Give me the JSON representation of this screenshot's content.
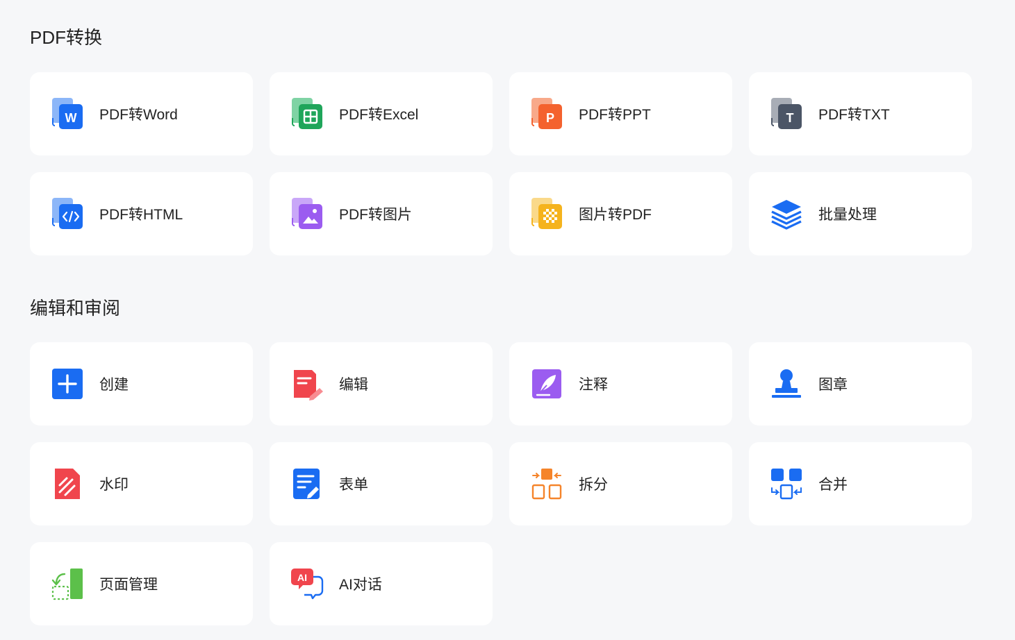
{
  "sections": [
    {
      "title": "PDF转换",
      "items": [
        {
          "label": "PDF转Word",
          "icon": "pdf-to-word-icon"
        },
        {
          "label": "PDF转Excel",
          "icon": "pdf-to-excel-icon"
        },
        {
          "label": "PDF转PPT",
          "icon": "pdf-to-ppt-icon"
        },
        {
          "label": "PDF转TXT",
          "icon": "pdf-to-txt-icon"
        },
        {
          "label": "PDF转HTML",
          "icon": "pdf-to-html-icon"
        },
        {
          "label": "PDF转图片",
          "icon": "pdf-to-image-icon"
        },
        {
          "label": "图片转PDF",
          "icon": "image-to-pdf-icon"
        },
        {
          "label": "批量处理",
          "icon": "batch-layers-icon"
        }
      ]
    },
    {
      "title": "编辑和审阅",
      "items": [
        {
          "label": "创建",
          "icon": "create-plus-icon"
        },
        {
          "label": "编辑",
          "icon": "edit-document-icon"
        },
        {
          "label": "注释",
          "icon": "annotate-feather-icon"
        },
        {
          "label": "图章",
          "icon": "stamp-icon"
        },
        {
          "label": "水印",
          "icon": "watermark-icon"
        },
        {
          "label": "表单",
          "icon": "form-icon"
        },
        {
          "label": "拆分",
          "icon": "split-icon"
        },
        {
          "label": "合并",
          "icon": "merge-icon"
        },
        {
          "label": "页面管理",
          "icon": "page-management-icon"
        },
        {
          "label": "AI对话",
          "icon": "ai-chat-icon"
        }
      ]
    }
  ],
  "colors": {
    "background": "#f6f7f9",
    "card": "#ffffff",
    "word": "#1a6cf2",
    "excel": "#1fa55a",
    "ppt": "#f4622e",
    "txt": "#4b5566",
    "html": "#1a6cf2",
    "image": "#9b5cf0",
    "image_to_pdf": "#f5b31d",
    "batch": "#1a6cf2",
    "create": "#1a6cf2",
    "edit": "#f0454d",
    "annotate": "#9b5cf0",
    "stamp": "#1a6cf2",
    "watermark": "#f0454d",
    "form": "#1a6cf2",
    "split": "#f5842a",
    "merge": "#1a6cf2",
    "page_mgmt": "#5cc04a",
    "ai": "#f0454d"
  }
}
